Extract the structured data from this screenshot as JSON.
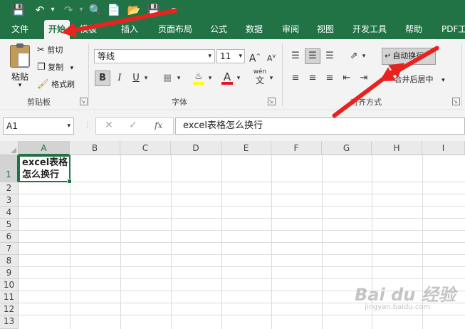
{
  "tabs": [
    "文件",
    "开始",
    "模板",
    "插入",
    "页面布局",
    "公式",
    "数据",
    "审阅",
    "视图",
    "开发工具",
    "帮助",
    "PDF工"
  ],
  "active_tab": "开始",
  "clipboard": {
    "paste_label": "粘贴",
    "cut_label": "剪切",
    "copy_label": "复制",
    "format_painter_label": "格式刷",
    "group_label": "剪贴板"
  },
  "font": {
    "font_name": "等线",
    "font_size": "11",
    "grow_label": "A",
    "shrink_label": "A",
    "bold": "B",
    "italic": "I",
    "underline": "U",
    "font_color_letter": "A",
    "phonetic_label": "wén",
    "group_label": "字体"
  },
  "alignment": {
    "wrap_text_label": "自动换行",
    "merge_center_label": "合并后居中",
    "group_label": "对齐方式"
  },
  "formula_bar": {
    "name_box": "A1",
    "fx_label": "fx",
    "content": "excel表格怎么换行"
  },
  "grid": {
    "columns": [
      "A",
      "B",
      "C",
      "D",
      "E",
      "F",
      "G",
      "H",
      "I"
    ],
    "rows": [
      "1",
      "2",
      "3",
      "4",
      "5",
      "6",
      "7",
      "8",
      "9",
      "10",
      "11",
      "12",
      "13"
    ],
    "cell_a1_line1": "excel表格",
    "cell_a1_line2": "怎么换行"
  },
  "watermark": {
    "text": "Bai du 经验",
    "sub": "jingyan.baidu.com"
  },
  "colors": {
    "excel_green": "#217346",
    "arrow_red": "#e8231f",
    "font_color_bar": "#e81123",
    "fill_color_bar": "#ffff00"
  }
}
